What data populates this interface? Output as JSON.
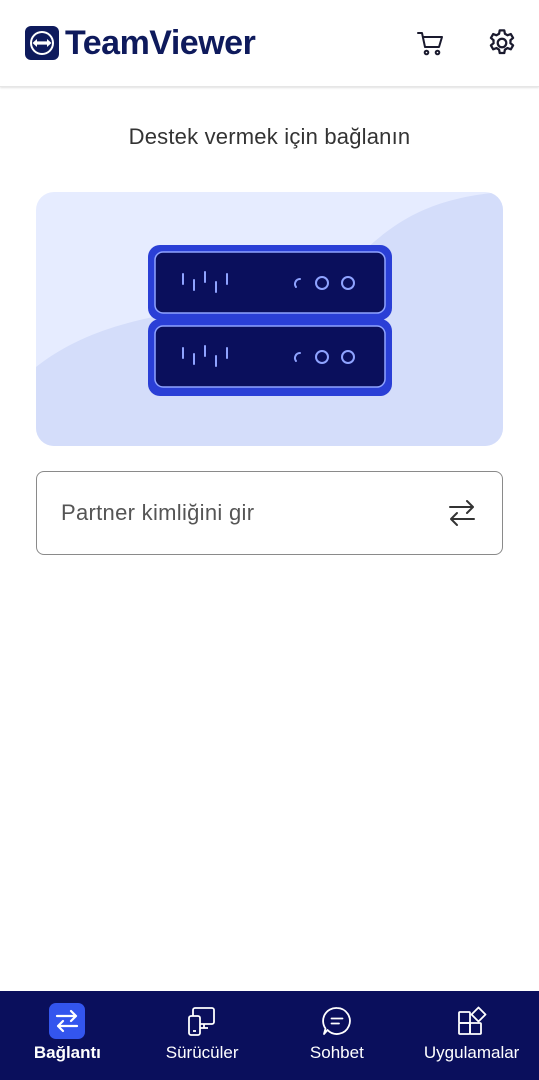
{
  "header": {
    "logo_text": "TeamViewer",
    "icons": [
      "cart-icon",
      "gear-icon"
    ]
  },
  "main": {
    "title": "Destek vermek için bağlanın",
    "partner_field": {
      "placeholder": "Partner kimliğini gir",
      "value": ""
    }
  },
  "bottom_nav": {
    "items": [
      {
        "label": "Bağlantı",
        "icon": "swap-arrows-icon",
        "active": true
      },
      {
        "label": "Sürücüler",
        "icon": "devices-icon",
        "active": false
      },
      {
        "label": "Sohbet",
        "icon": "chat-icon",
        "active": false
      },
      {
        "label": "Uygulamalar",
        "icon": "apps-icon",
        "active": false
      }
    ]
  },
  "colors": {
    "brand": "#0e1a5c",
    "nav_background": "#0a0f5c",
    "nav_active": "#3355ee",
    "hero_background": "#e6ecff"
  }
}
